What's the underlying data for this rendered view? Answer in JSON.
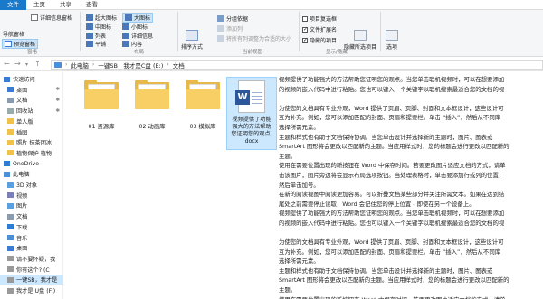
{
  "ribbon_tabs": [
    "文件",
    "主页",
    "共享",
    "查看"
  ],
  "ribbon": {
    "pane_group": {
      "nav_pane": "导航窗格",
      "preview_pane": "预览窗格",
      "details_pane": "详细信息窗格",
      "label": "窗格"
    },
    "layout_group": {
      "items": [
        "超大图标",
        "大图标",
        "中图标",
        "小图标",
        "列表",
        "详细信息",
        "平铺",
        "内容"
      ],
      "selected": "大图标",
      "label": "布局"
    },
    "view_group": {
      "sort": "排序方式",
      "group_by": "分组依据",
      "add_columns": "添加列",
      "fit_columns": "将所有列调整为合适的大小",
      "label": "当前视图"
    },
    "showhide_group": {
      "item_checkbox": "项目复选框",
      "extensions": "文件扩展名",
      "hidden_items": "隐藏的项目",
      "hide_selected": "隐藏所选项目",
      "label": "显示/隐藏"
    },
    "options": "选项"
  },
  "address": {
    "crumbs": [
      "此电脑",
      "一键SB，我才是C盘 (E:)",
      "文档"
    ]
  },
  "nav": [
    {
      "label": "快速访问",
      "icon": "star-icon",
      "pinned": false,
      "selected": false
    },
    {
      "label": "桌面",
      "icon": "desktop-icon",
      "pinned": true,
      "selected": false
    },
    {
      "label": "文档",
      "icon": "documents-icon",
      "pinned": true,
      "selected": false
    },
    {
      "label": "回收站",
      "icon": "recycle-bin-icon",
      "pinned": true,
      "selected": false
    },
    {
      "label": "单人版",
      "icon": "folder-icon",
      "pinned": false,
      "selected": false
    },
    {
      "label": "插图",
      "icon": "folder-icon",
      "pinned": false,
      "selected": false
    },
    {
      "label": "照片 抹茶团冰",
      "icon": "folder-icon",
      "pinned": false,
      "selected": false
    },
    {
      "label": "植物保护 植物",
      "icon": "folder-icon",
      "pinned": false,
      "selected": false
    },
    {
      "label": "OneDrive",
      "icon": "cloud-icon",
      "pinned": false,
      "selected": false
    },
    {
      "label": "此电脑",
      "icon": "computer-icon",
      "pinned": false,
      "selected": false
    },
    {
      "label": "3D 对象",
      "icon": "cube-icon",
      "pinned": false,
      "selected": false
    },
    {
      "label": "视频",
      "icon": "video-icon",
      "pinned": false,
      "selected": false
    },
    {
      "label": "图片",
      "icon": "pictures-icon",
      "pinned": false,
      "selected": false
    },
    {
      "label": "文档",
      "icon": "documents-icon",
      "pinned": false,
      "selected": false
    },
    {
      "label": "下载",
      "icon": "download-icon",
      "pinned": false,
      "selected": false
    },
    {
      "label": "音乐",
      "icon": "music-icon",
      "pinned": false,
      "selected": false
    },
    {
      "label": "桌面",
      "icon": "desktop-icon",
      "pinned": false,
      "selected": false
    },
    {
      "label": "请不要怀疑，我",
      "icon": "drive-icon",
      "pinned": false,
      "selected": false
    },
    {
      "label": "你有这个? (C",
      "icon": "drive-icon",
      "pinned": false,
      "selected": false
    },
    {
      "label": "一键SB，我才是",
      "icon": "drive-icon",
      "pinned": false,
      "selected": true
    },
    {
      "label": "我才是 U盘 (F:)",
      "icon": "drive-icon",
      "pinned": false,
      "selected": false
    }
  ],
  "files": [
    {
      "name": "01 资源库",
      "type": "folder"
    },
    {
      "name": "02 动画库",
      "type": "folder"
    },
    {
      "name": "03 模拟库",
      "type": "folder"
    }
  ],
  "selected_file": {
    "name": "视频提供了功能强大的方法帮助您证明您的观点.docx",
    "type": "docx",
    "lines": [
      "视频提供了功能",
      "强大的方法帮助",
      "您证明您的观点.",
      "docx"
    ]
  },
  "preview_lines": [
    "视频提供了功能强大的方法帮助您证明您的观点。当您单击联机视频时，可以在想要添加",
    "的视频的嵌入代码中进行粘贴。您也可以键入一个关键字以联机搜索最适合您的文档的视",
    "",
    "为使您的文档具有专业外观，Word 提供了页眉、页脚、封面和文本框设计，这些设计可",
    "互为补充。例如，您可以添加匹配的封面、页眉和提要栏。单击 “插入”，然后从不同库",
    "选择所需元素。",
    "主题和样式也有助于文档保持协调。当您单击设计并选择新的主题时，图片、图表或",
    "SmartArt 图形将会更改以匹配新的主题。当应用样式时，您的标题会进行更改以匹配新的",
    "主题。",
    "使用在需要位置出现的新按钮在 Word 中保存时间。若要更改图片适应文档的方式，请单",
    "击该图片，图片旁边将会显示布局选项按钮。当处理表格时，单击要添加行或列的位置，",
    "然后单击加号。",
    "在新的阅读视图中阅读更加容易。可以折叠文档某些部分并关注所需文本。如果在达到结",
    "尾处之前需要停止读取，Word 会记住您的停止位置 - 即使在另一个设备上。",
    "视频提供了功能强大的方法帮助您证明您的观点。当您单击联机视频时，可以在想要添加",
    "的视频的嵌入代码中进行粘贴。您也可以键入一个关键字以联机搜索最适合您的文档的视",
    "",
    "为使您的文档具有专业外观，Word 提供了页眉、页脚、封面和文本框设计，这些设计可",
    "互为补充。例如，您可以添加匹配的封面、页眉和提要栏。单击 “插入”，然后从不同库",
    "选择所需元素。",
    "主题和样式也有助于文档保持协调。当您单击设计并选择新的主题时，图片、图表或",
    "SmartArt 图形将会更改以匹配新的主题。当应用样式时，您的标题会进行更改以匹配新的",
    "主题。",
    "使用在需要位置出现的新按钮在 Word 中保存时间。若要更改图片适应文档的方式，请单"
  ],
  "colors": {
    "accent": "#1979ca",
    "folder": "#f7cf64",
    "selection": "#cce8ff",
    "word": "#2b579a"
  }
}
